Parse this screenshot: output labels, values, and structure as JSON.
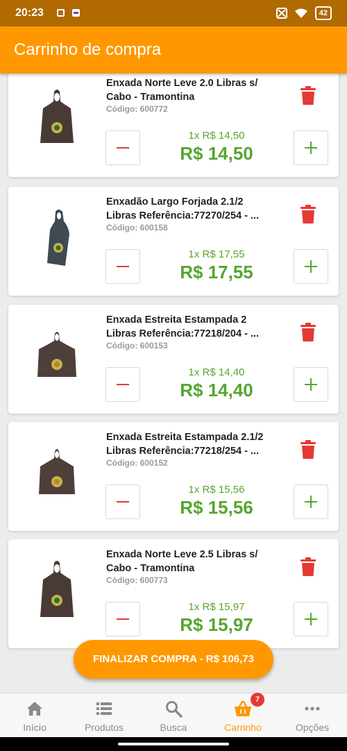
{
  "status_bar": {
    "time": "20:23",
    "battery": "42"
  },
  "header": {
    "title": "Carrinho de compra"
  },
  "cart": {
    "items": [
      {
        "name": "Enxada Norte Leve 2.0 Libras s/\nCabo - Tramontina",
        "code": "Código: 600772",
        "unit_price": "1x R$ 14,50",
        "total": "R$ 14,50"
      },
      {
        "name": "Enxadão Largo Forjada 2.1/2\nLibras Referência:77270/254 - ...",
        "code": "Código: 600158",
        "unit_price": "1x R$ 17,55",
        "total": "R$ 17,55"
      },
      {
        "name": "Enxada Estreita Estampada 2\nLibras Referência:77218/204 - ...",
        "code": "Código: 600153",
        "unit_price": "1x R$ 14,40",
        "total": "R$ 14,40"
      },
      {
        "name": "Enxada Estreita Estampada 2.1/2\nLibras Referência:77218/254 - ...",
        "code": "Código: 600152",
        "unit_price": "1x R$ 15,56",
        "total": "R$ 15,56"
      },
      {
        "name": "Enxada Norte Leve 2.5 Libras s/\nCabo - Tramontina",
        "code": "Código: 600773",
        "unit_price": "1x R$ 15,97",
        "total": "R$ 15,97"
      }
    ]
  },
  "checkout": {
    "label": "FINALIZAR COMPRA - R$ 106,73"
  },
  "bottom_nav": {
    "items": [
      {
        "label": "Início",
        "icon": "home-icon"
      },
      {
        "label": "Produtos",
        "icon": "list-icon"
      },
      {
        "label": "Busca",
        "icon": "search-icon"
      },
      {
        "label": "Carrinho",
        "icon": "basket-icon",
        "badge": "7",
        "active": true
      },
      {
        "label": "Opções",
        "icon": "more-icon"
      }
    ]
  },
  "colors": {
    "primary": "#ff9800",
    "status_bar": "#b06a00",
    "price_green": "#55a630",
    "delete_red": "#e53935"
  }
}
